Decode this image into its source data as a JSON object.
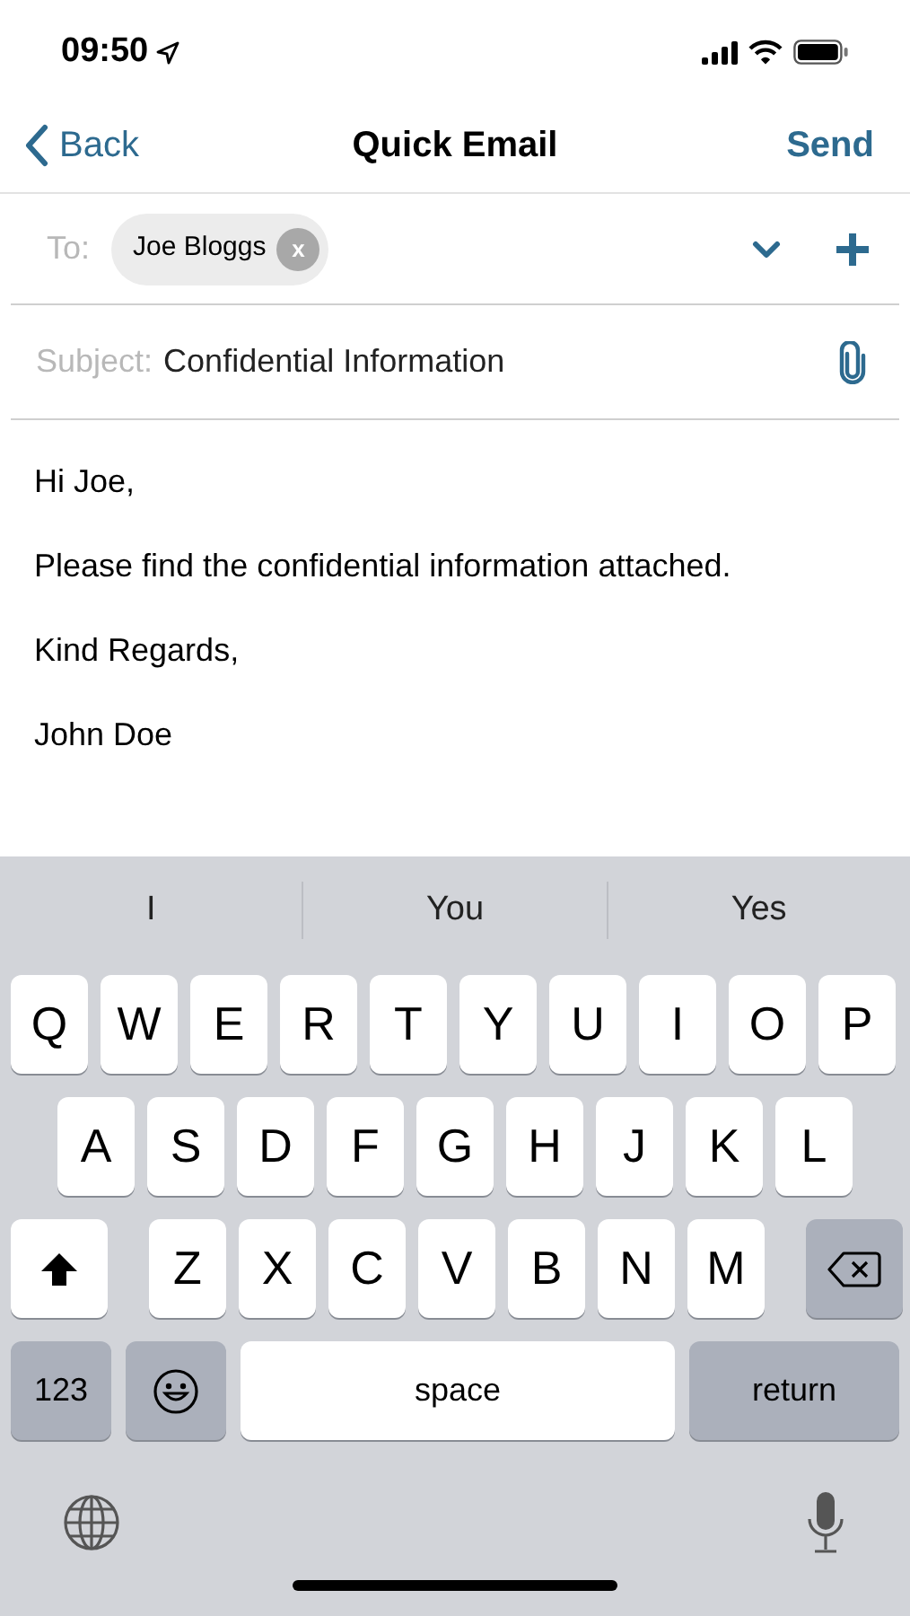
{
  "status_bar": {
    "time": "09:50"
  },
  "nav": {
    "back": "Back",
    "title": "Quick Email",
    "action": "Send"
  },
  "to": {
    "label": "To:",
    "recipients": [
      {
        "name": "Joe Bloggs",
        "remove": "x"
      }
    ]
  },
  "subject": {
    "label": "Subject:",
    "value": "Confidential Information"
  },
  "body": [
    "Hi Joe,",
    "Please find the confidential information attached.",
    "Kind Regards,",
    "John Doe"
  ],
  "suggestions": [
    "I",
    "You",
    "Yes"
  ],
  "keyboard": {
    "rows": [
      [
        {
          "kind": "letter",
          "label": "Q"
        },
        {
          "kind": "letter",
          "label": "W"
        },
        {
          "kind": "letter",
          "label": "E"
        },
        {
          "kind": "letter",
          "label": "R"
        },
        {
          "kind": "letter",
          "label": "T"
        },
        {
          "kind": "letter",
          "label": "Y"
        },
        {
          "kind": "letter",
          "label": "U"
        },
        {
          "kind": "letter",
          "label": "I"
        },
        {
          "kind": "letter",
          "label": "O"
        },
        {
          "kind": "letter",
          "label": "P"
        }
      ],
      [
        {
          "kind": "letter",
          "label": "A"
        },
        {
          "kind": "letter",
          "label": "S"
        },
        {
          "kind": "letter",
          "label": "D"
        },
        {
          "kind": "letter",
          "label": "F"
        },
        {
          "kind": "letter",
          "label": "G"
        },
        {
          "kind": "letter",
          "label": "H"
        },
        {
          "kind": "letter",
          "label": "J"
        },
        {
          "kind": "letter",
          "label": "K"
        },
        {
          "kind": "letter",
          "label": "L"
        }
      ],
      [
        {
          "kind": "shift"
        },
        {
          "kind": "letter",
          "label": "Z"
        },
        {
          "kind": "letter",
          "label": "X"
        },
        {
          "kind": "letter",
          "label": "C"
        },
        {
          "kind": "letter",
          "label": "V"
        },
        {
          "kind": "letter",
          "label": "B"
        },
        {
          "kind": "letter",
          "label": "N"
        },
        {
          "kind": "letter",
          "label": "M"
        },
        {
          "kind": "delete"
        }
      ]
    ],
    "function_keys": [
      {
        "kind": "numbers",
        "label": "123"
      },
      {
        "kind": "emoji"
      },
      {
        "kind": "space",
        "label": "space"
      },
      {
        "kind": "return",
        "label": "return"
      }
    ]
  }
}
